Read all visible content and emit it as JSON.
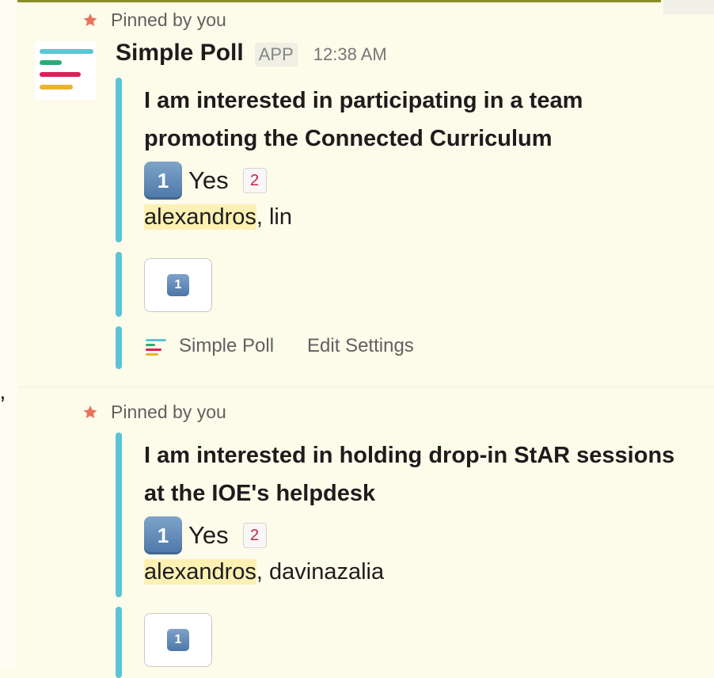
{
  "messages": [
    {
      "pinned_label": "Pinned by you",
      "sender": "Simple Poll",
      "badge": "APP",
      "time": "12:38 AM",
      "question": [
        "I am interested in participating in a team",
        "promoting the Connected Curriculum"
      ],
      "option": {
        "number": "1",
        "label": "Yes",
        "count": "2"
      },
      "voters_highlight": "alexandros",
      "voters_rest": ", lin",
      "vote_button_number": "1",
      "footer": {
        "app_label": "Simple Poll",
        "settings_label": "Edit Settings"
      }
    },
    {
      "pinned_label": "Pinned by you",
      "question": [
        "I am interested in holding drop-in StAR sessions",
        "at the IOE's helpdesk"
      ],
      "option": {
        "number": "1",
        "label": "Yes",
        "count": "2"
      },
      "voters_highlight": "alexandros",
      "voters_rest": ", davinazalia",
      "vote_button_number": "1"
    }
  ],
  "stray_char": "’",
  "colors": {
    "background": "#fdfbe9",
    "attachment_bar": "#5bc4d6",
    "pin": "#e8735c",
    "count_text": "#c3214f",
    "voter_highlight": "#fdf0b3",
    "logo_bars": [
      "#5bc4d6",
      "#2bac76",
      "#e01e5a",
      "#ecb22e"
    ]
  },
  "icons": {
    "pin": "pushpin-icon",
    "logo": "simple-poll-logo-icon",
    "keycap": "keycap-1-icon"
  }
}
